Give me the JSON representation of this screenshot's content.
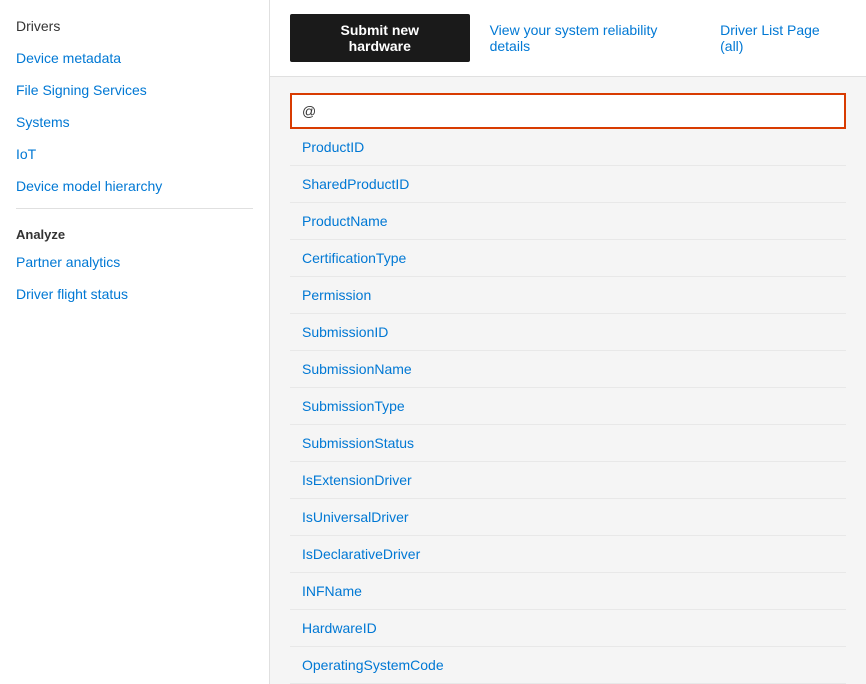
{
  "sidebar": {
    "items": [
      {
        "id": "drivers",
        "label": "Drivers",
        "color": "plain"
      },
      {
        "id": "device-metadata",
        "label": "Device metadata",
        "color": "link"
      },
      {
        "id": "file-signing-services",
        "label": "File Signing Services",
        "color": "link"
      },
      {
        "id": "systems",
        "label": "Systems",
        "color": "link"
      },
      {
        "id": "iot",
        "label": "IoT",
        "color": "link"
      },
      {
        "id": "device-model-hierarchy",
        "label": "Device model hierarchy",
        "color": "link"
      }
    ],
    "analyze_label": "Analyze",
    "analyze_items": [
      {
        "id": "partner-analytics",
        "label": "Partner analytics"
      },
      {
        "id": "driver-flight-status",
        "label": "Driver flight status"
      }
    ]
  },
  "toolbar": {
    "submit_label": "Submit new hardware",
    "reliability_link": "View your system reliability details",
    "driver_list_link": "Driver List Page (all)"
  },
  "filter": {
    "icon": "@",
    "placeholder": ""
  },
  "list": {
    "items": [
      "ProductID",
      "SharedProductID",
      "ProductName",
      "CertificationType",
      "Permission",
      "SubmissionID",
      "SubmissionName",
      "SubmissionType",
      "SubmissionStatus",
      "IsExtensionDriver",
      "IsUniversalDriver",
      "IsDeclarativeDriver",
      "INFName",
      "HardwareID",
      "OperatingSystemCode"
    ]
  }
}
